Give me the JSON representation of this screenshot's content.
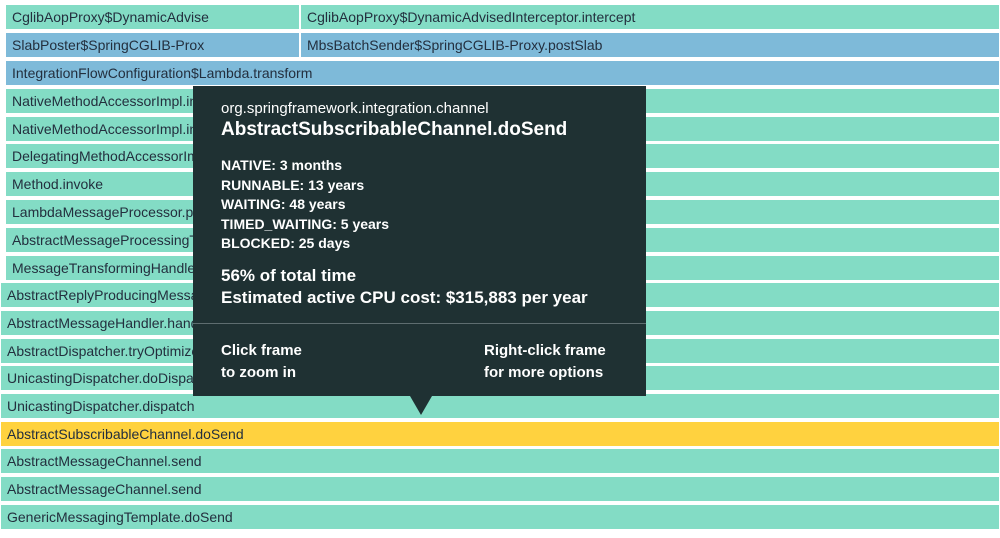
{
  "flame_graph": {
    "rows": [
      {
        "row": "row0",
        "cells": [
          "CglibAopProxy$DynamicAdvise",
          "CglibAopProxy$DynamicAdvisedInterceptor.intercept"
        ]
      },
      {
        "row": "row1",
        "cells": [
          "SlabPoster$SpringCGLIB-Prox",
          "MbsBatchSender$SpringCGLIB-Proxy.postSlab"
        ]
      },
      {
        "row": "row2",
        "cells": [
          "IntegrationFlowConfiguration$Lambda.transform"
        ]
      },
      {
        "row": "row3",
        "cells": [
          "NativeMethodAccessorImpl.invoke0"
        ]
      },
      {
        "row": "row4",
        "cells": [
          "NativeMethodAccessorImpl.invoke"
        ]
      },
      {
        "row": "row5",
        "cells": [
          "DelegatingMethodAccessorImpl.invoke"
        ]
      },
      {
        "row": "row6",
        "cells": [
          "Method.invoke"
        ]
      },
      {
        "row": "row7",
        "cells": [
          "LambdaMessageProcessor.processMessage"
        ]
      },
      {
        "row": "row8",
        "cells": [
          "AbstractMessageProcessingTransformer.transform"
        ]
      },
      {
        "row": "row9",
        "cells": [
          "MessageTransformingHandler.handleRequestMessage"
        ]
      },
      {
        "row": "row10",
        "cells": [
          "AbstractReplyProducingMessageHandler.handleMessageInternal"
        ]
      },
      {
        "row": "row11",
        "cells": [
          "AbstractMessageHandler.handleMessage"
        ]
      },
      {
        "row": "row12",
        "cells": [
          "AbstractDispatcher.tryOptimizedDispatch"
        ]
      },
      {
        "row": "row13",
        "cells": [
          "UnicastingDispatcher.doDispatch"
        ]
      },
      {
        "row": "row14",
        "cells": [
          "UnicastingDispatcher.dispatch"
        ]
      },
      {
        "row": "row15",
        "cells": [
          "AbstractSubscribableChannel.doSend"
        ]
      },
      {
        "row": "row16",
        "cells": [
          "AbstractMessageChannel.send"
        ]
      },
      {
        "row": "row17",
        "cells": [
          "AbstractMessageChannel.send"
        ]
      },
      {
        "row": "row18",
        "cells": [
          "GenericMessagingTemplate.doSend"
        ]
      }
    ],
    "colors": {
      "frame_default": "#83dcc5",
      "frame_path": "#7ebad9",
      "frame_hovered": "#ffd23f",
      "tooltip_background": "#1f3133"
    }
  },
  "tooltip": {
    "package": "org.springframework.integration.channel",
    "method": "AbstractSubscribableChannel.doSend",
    "states": [
      "NATIVE: 3 months",
      "RUNNABLE: 13 years",
      "WAITING: 48 years",
      "TIMED_WAITING: 5 years",
      "BLOCKED: 25 days"
    ],
    "percent_total": "56% of total time",
    "cpu_cost": "Estimated active CPU cost: $315,883 per year",
    "hint_left_line1": "Click frame",
    "hint_left_line2": "to zoom in",
    "hint_right_line1": "Right-click frame",
    "hint_right_line2": "for more options"
  }
}
